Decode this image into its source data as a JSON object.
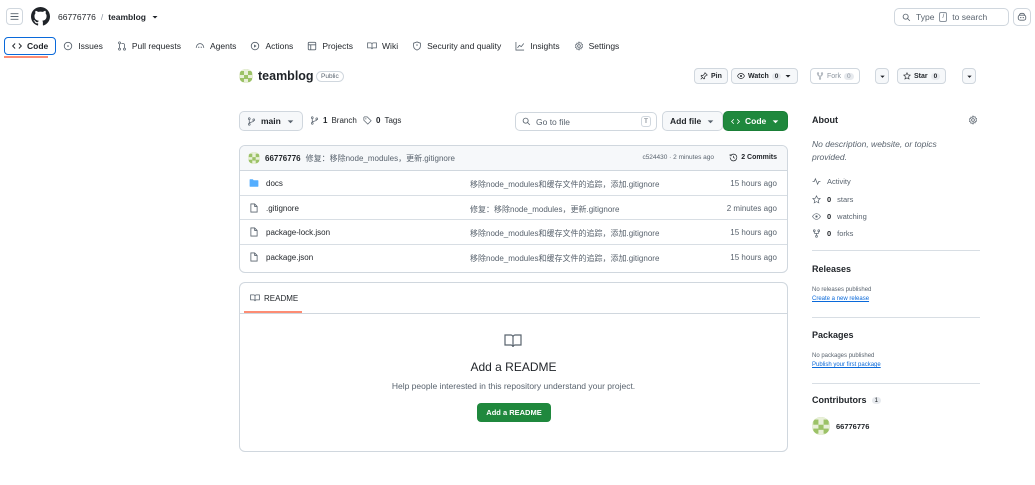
{
  "header": {
    "owner": "66776776",
    "separator": "/",
    "repo": "teamblog",
    "search_prefix": "Type",
    "search_key": "/",
    "search_suffix": "to search"
  },
  "tabs": [
    {
      "label": "Code",
      "icon": "code-icon",
      "active": true
    },
    {
      "label": "Issues",
      "icon": "issue-icon"
    },
    {
      "label": "Pull requests",
      "icon": "pull-request-icon"
    },
    {
      "label": "Agents",
      "icon": "agents-icon"
    },
    {
      "label": "Actions",
      "icon": "play-icon"
    },
    {
      "label": "Projects",
      "icon": "table-icon"
    },
    {
      "label": "Wiki",
      "icon": "book-icon"
    },
    {
      "label": "Security and quality",
      "icon": "shield-icon"
    },
    {
      "label": "Insights",
      "icon": "graph-icon"
    },
    {
      "label": "Settings",
      "icon": "gear-icon"
    }
  ],
  "repo_header": {
    "name": "teamblog",
    "visibility": "Public",
    "pin_label": "Pin",
    "watch_label": "Watch",
    "watch_count": "0",
    "fork_label": "Fork",
    "fork_count": "0",
    "star_label": "Star",
    "star_count": "0"
  },
  "toolbar": {
    "branch": "main",
    "branches_count": "1",
    "branches_label": "Branch",
    "tags_count": "0",
    "tags_label": "Tags",
    "goto_placeholder": "Go to file",
    "goto_key": "T",
    "add_file_label": "Add file",
    "code_label": "Code"
  },
  "commit": {
    "author": "66776776",
    "message": "修复：移除node_modules，更新.gitignore",
    "meta": "c524430 · 2 minutes ago",
    "count": "2 Commits"
  },
  "files": [
    {
      "name": "docs",
      "type": "folder",
      "message": "移除node_modules和缓存文件的追踪，添加.gitignore",
      "time": "15 hours ago"
    },
    {
      "name": ".gitignore",
      "type": "file",
      "message": "修复：移除node_modules，更新.gitignore",
      "time": "2 minutes ago"
    },
    {
      "name": "package-lock.json",
      "type": "file",
      "message": "移除node_modules和缓存文件的追踪，添加.gitignore",
      "time": "15 hours ago"
    },
    {
      "name": "package.json",
      "type": "file",
      "message": "移除node_modules和缓存文件的追踪，添加.gitignore",
      "time": "15 hours ago"
    }
  ],
  "readme": {
    "tab_label": "README",
    "title": "Add a README",
    "subtitle": "Help people interested in this repository understand your project.",
    "button": "Add a README"
  },
  "sidebar": {
    "about_title": "About",
    "description": "No description, website, or topics provided.",
    "activity": "Activity",
    "stars_count": "0",
    "stars_label": "stars",
    "watching_count": "0",
    "watching_label": "watching",
    "forks_count": "0",
    "forks_label": "forks",
    "releases_title": "Releases",
    "releases_note": "No releases published",
    "releases_link": "Create a new release",
    "packages_title": "Packages",
    "packages_note": "No packages published",
    "packages_link": "Publish your first package",
    "contributors_title": "Contributors",
    "contributors_count": "1",
    "contributor_name": "66776776"
  },
  "colors": {
    "accent": "#0969da",
    "primary_button": "#1f883d",
    "tab_underline": "#fd8c73",
    "border": "#d0d7de",
    "muted_text": "#59636e"
  }
}
